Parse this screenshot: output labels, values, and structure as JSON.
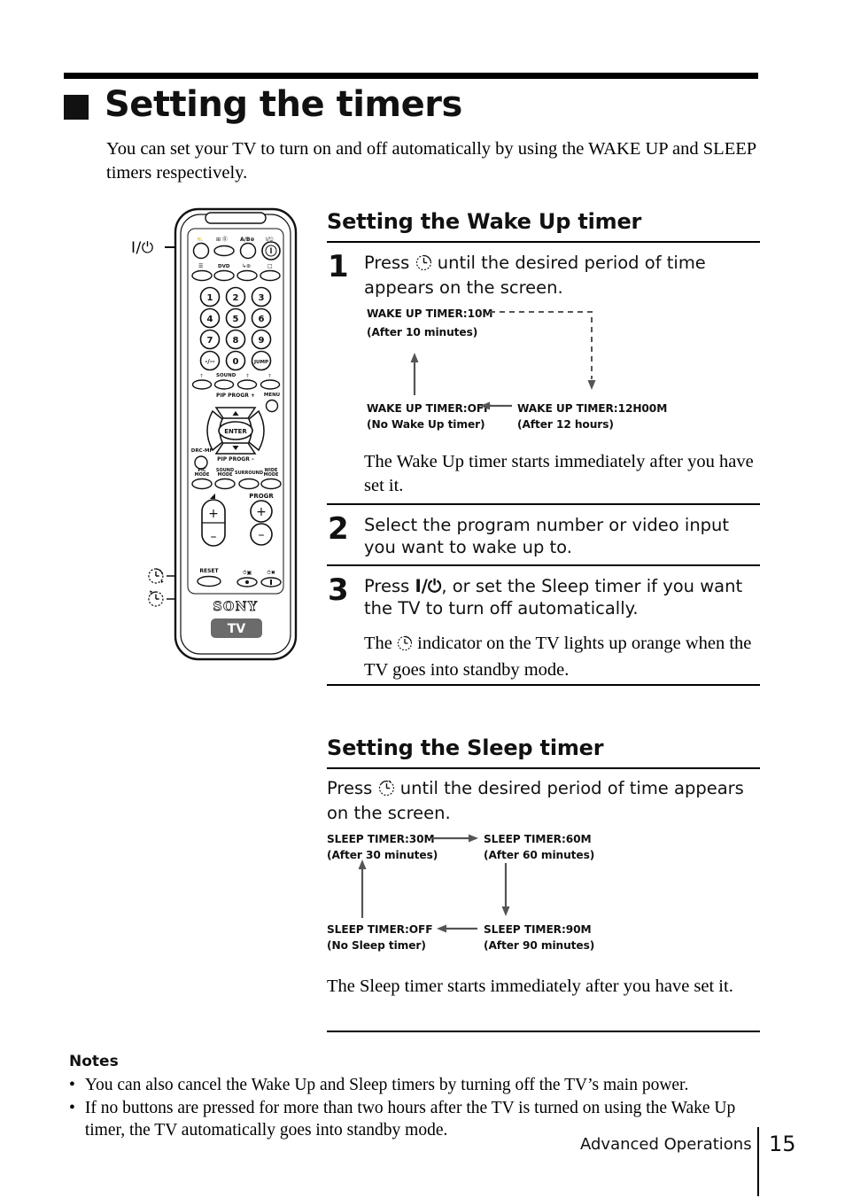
{
  "document": {
    "title": "Setting the timers",
    "intro": "You can set your TV to turn on and off automatically by using the WAKE UP and SLEEP timers respectively.",
    "bullet_glyph": "•",
    "title_marker": "■"
  },
  "remote": {
    "brand": "SONY",
    "mode_button": "TV",
    "callout_power": "I/⏻",
    "callout_wakeup_icon": "wake-up-timer-icon",
    "callout_sleep_icon": "sleep-timer-icon",
    "row1": [
      "mute",
      "text-hold",
      "a-b",
      "power"
    ],
    "row1_labels": [
      "",
      "⬜ ⓣ",
      "A/B ⊕",
      "I/⏻"
    ],
    "row2_labels": [
      "☰",
      "DVD",
      "↴ ⊗",
      "⬜"
    ],
    "keypad": [
      "1",
      "2",
      "3",
      "4",
      "5",
      "6",
      "7",
      "8",
      "9",
      "-/--",
      "0",
      "JUMP"
    ],
    "teletext_row_label": "SOUND",
    "pip_plus": "PIP PROGR +",
    "pip_minus": "PIP PROGR –",
    "menu": "MENU",
    "enter": "ENTER",
    "drc": "DRC-MF",
    "mode_row": [
      "PIC MODE",
      "SOUND MODE",
      "SURROUND",
      "WIDE MODE"
    ],
    "volume_label": "◢",
    "progr_label": "PROGR",
    "reset": "RESET",
    "plus": "+",
    "minus": "–"
  },
  "wake_up": {
    "heading": "Setting the Wake Up timer",
    "steps": [
      {
        "number": "1",
        "text_before": "Press ",
        "text_after": " until the desired period of time appears on the screen.",
        "icon": "wake-up-timer-icon",
        "note": "The Wake Up timer starts immediately after you have set it."
      },
      {
        "number": "2",
        "text": "Select the program number or video input you want to wake up to."
      },
      {
        "number": "3",
        "text_before": "Press ",
        "text_middle": "I/⏻",
        "text_after": ", or set the Sleep timer if you want the TV to turn off automatically.",
        "note_before": "The ",
        "note_after": " indicator on the TV lights up orange when the TV goes into standby mode."
      }
    ],
    "diagram": {
      "nodes": [
        {
          "label": "WAKE UP TIMER:10M",
          "sub": "(After 10 minutes)"
        },
        {
          "label": "WAKE UP TIMER:12H00M",
          "sub": "(After 12 hours)"
        },
        {
          "label": "WAKE UP TIMER:OFF",
          "sub": "(No Wake Up timer)"
        }
      ]
    }
  },
  "sleep": {
    "heading": "Setting the Sleep timer",
    "instruction_before": "Press ",
    "instruction_after": " until the desired period of time appears on the screen.",
    "icon": "sleep-timer-icon",
    "note": "The Sleep timer starts immediately after you have set it.",
    "diagram": {
      "nodes": [
        {
          "label": "SLEEP TIMER:30M",
          "sub": "(After 30 minutes)"
        },
        {
          "label": "SLEEP TIMER:60M",
          "sub": "(After 60 minutes)"
        },
        {
          "label": "SLEEP TIMER:90M",
          "sub": "(After 90 minutes)"
        },
        {
          "label": "SLEEP TIMER:OFF",
          "sub": "(No Sleep timer)"
        }
      ]
    }
  },
  "notes": {
    "heading": "Notes",
    "items": [
      "You can also cancel the Wake Up and Sleep timers by turning off the TV’s main power.",
      "If no buttons are pressed for more than two hours after the TV is turned on using the Wake Up timer, the TV automatically goes into standby mode."
    ]
  },
  "footer": {
    "section": "Advanced Operations",
    "page": "15"
  }
}
